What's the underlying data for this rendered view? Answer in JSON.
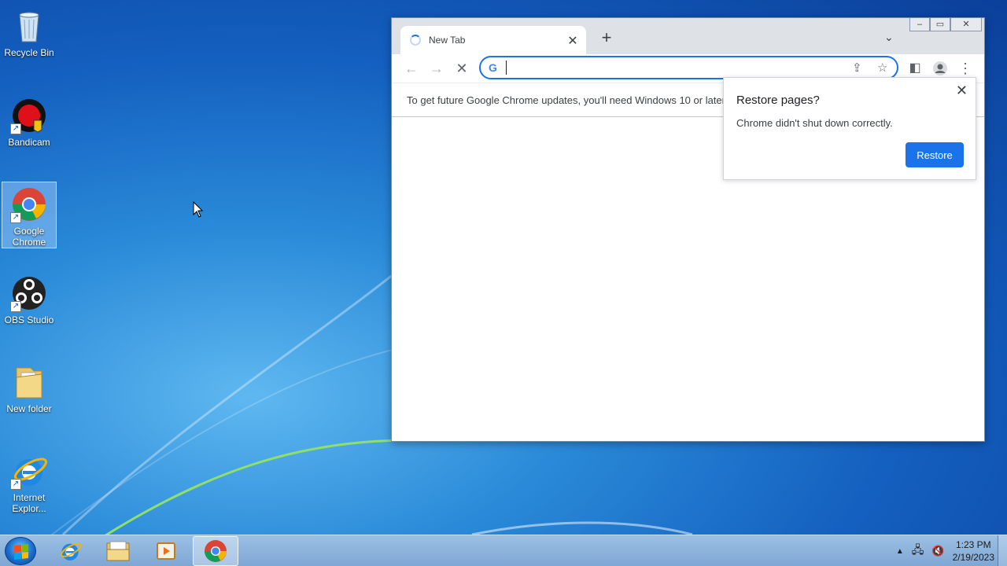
{
  "desktop": {
    "icons": [
      {
        "label": "Recycle Bin"
      },
      {
        "label": "Bandicam"
      },
      {
        "label": "Google Chrome"
      },
      {
        "label": "OBS Studio"
      },
      {
        "label": "New folder"
      },
      {
        "label": "Internet Explor..."
      }
    ]
  },
  "browser": {
    "tab_title": "New Tab",
    "omnibox_value": "",
    "infobar_text": "To get future Google Chrome updates, you'll need Windows 10 or later.",
    "restore_bubble": {
      "title": "Restore pages?",
      "message": "Chrome didn't shut down correctly.",
      "button": "Restore"
    }
  },
  "taskbar": {
    "time": "1:23 PM",
    "date": "2/19/2023"
  },
  "colors": {
    "accent": "#1a73e8",
    "desktop": "#1460c0"
  }
}
